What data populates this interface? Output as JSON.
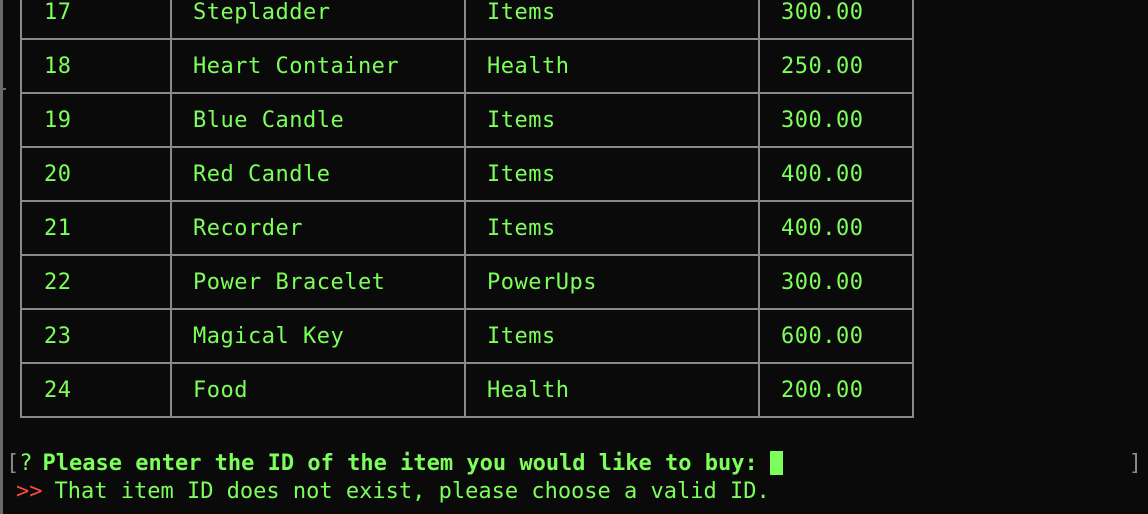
{
  "table": {
    "rows": [
      {
        "id": "17",
        "name": "Stepladder",
        "category": "Items",
        "price": "300.00"
      },
      {
        "id": "18",
        "name": "Heart Container",
        "category": "Health",
        "price": "250.00"
      },
      {
        "id": "19",
        "name": "Blue Candle",
        "category": "Items",
        "price": "300.00"
      },
      {
        "id": "20",
        "name": "Red Candle",
        "category": "Items",
        "price": "400.00"
      },
      {
        "id": "21",
        "name": "Recorder",
        "category": "Items",
        "price": "400.00"
      },
      {
        "id": "22",
        "name": "Power Bracelet",
        "category": "PowerUps",
        "price": "300.00"
      },
      {
        "id": "23",
        "name": "Magical Key",
        "category": "Items",
        "price": "600.00"
      },
      {
        "id": "24",
        "name": "Food",
        "category": "Health",
        "price": "200.00"
      }
    ]
  },
  "prompt": {
    "open_bracket": "[",
    "question_mark": "?",
    "text": "Please enter the ID of the item you would like to buy:",
    "close_bracket": "]"
  },
  "error": {
    "marker": ">>",
    "text": "That item ID does not exist, please choose a valid ID."
  },
  "colors": {
    "text_green": "#7cff5a",
    "border_gray": "#8a8a8a",
    "error_red": "#ff4a3a",
    "background": "#0a0a0a"
  }
}
